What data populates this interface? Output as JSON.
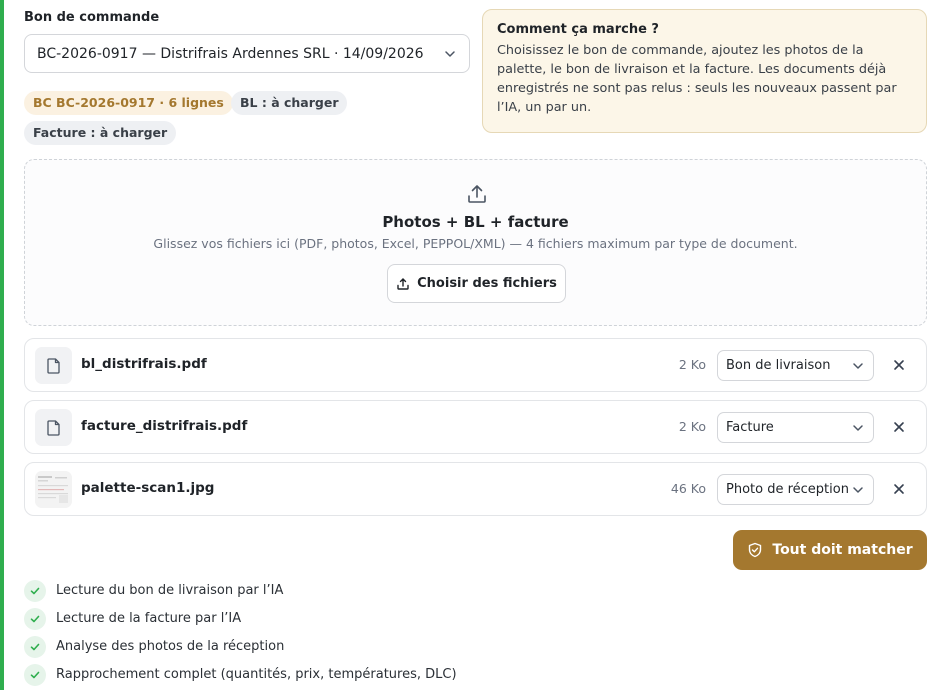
{
  "purchase_order": {
    "label": "Bon de commande",
    "selected": "BC-2026-0917 — Distrifrais Ardennes SRL · 14/09/2026"
  },
  "badges": {
    "po": "BC BC-2026-0917 · 6 lignes",
    "bl": "BL : à charger",
    "invoice": "Facture : à charger"
  },
  "how_it_works": {
    "title": "Comment ça marche ?",
    "text": "Choisissez le bon de commande, ajoutez les photos de la palette, le bon de livraison et la facture. Les documents déjà enregistrés ne sont pas relus : seuls les nouveaux passent par l’IA, un par un."
  },
  "dropzone": {
    "title": "Photos + BL + facture",
    "subtitle": "Glissez vos fichiers ici (PDF, photos, Excel, PEPPOL/XML) — 4 fichiers maximum par type de document.",
    "button_label": "Choisir des fichiers"
  },
  "files": [
    {
      "name": "bl_distrifrais.pdf",
      "size": "2 Ko",
      "type": "Bon de livraison",
      "icon": "file-icon"
    },
    {
      "name": "facture_distrifrais.pdf",
      "size": "2 Ko",
      "type": "Facture",
      "icon": "file-icon"
    },
    {
      "name": "palette-scan1.jpg",
      "size": "46 Ko",
      "type": "Photo de réception",
      "icon": "image-thumbnail"
    }
  ],
  "action": {
    "label": "Tout doit matcher",
    "icon": "shield-check-icon"
  },
  "steps": [
    "Lecture du bon de livraison par l’IA",
    "Lecture de la facture par l’IA",
    "Analyse des photos de la réception",
    "Rapprochement complet (quantités, prix, températures, DLC)"
  ],
  "colors": {
    "accent": "#a4782f",
    "left_bar": "#2fae4e",
    "check": "#2fae4e",
    "info_bg": "#fcf6e8"
  }
}
